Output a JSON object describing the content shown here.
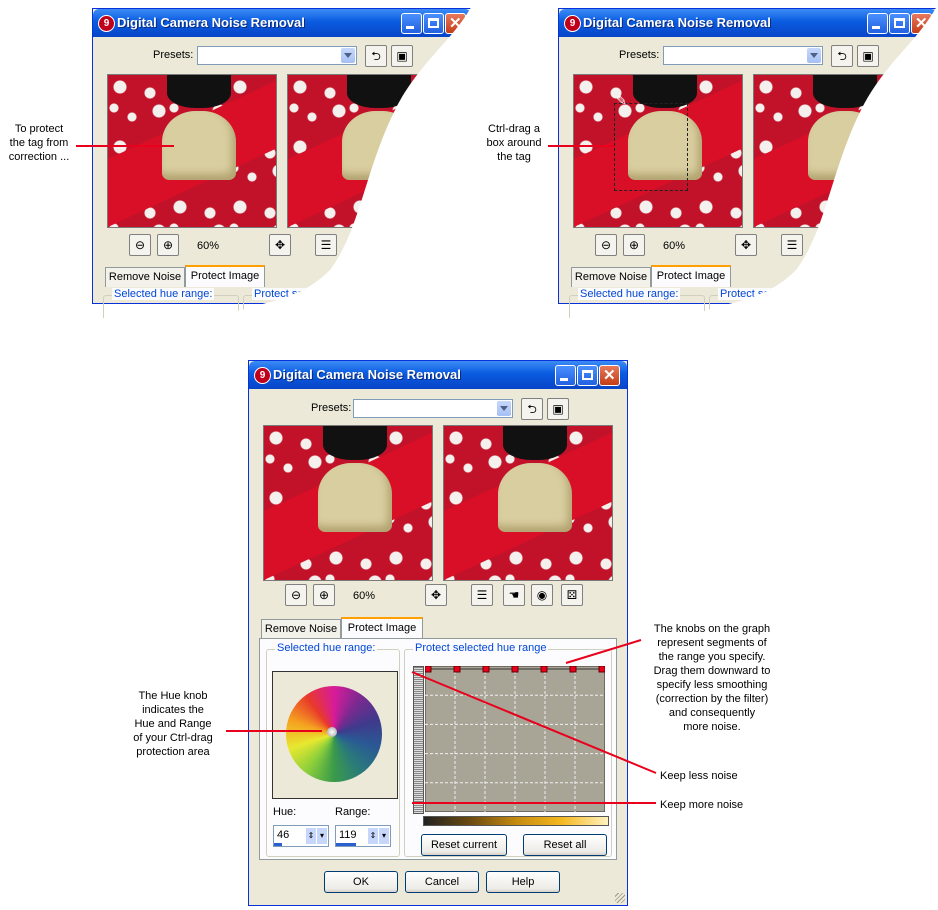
{
  "dialog": {
    "title": "Digital Camera Noise Removal",
    "app_icon": "9",
    "presets_label": "Presets:",
    "presets_value": "",
    "zoom": "60%",
    "tabs": [
      "Remove Noise",
      "Protect Image"
    ],
    "selected_hue_range": "Selected hue range:",
    "protect_selected_hue_range": "Protect selected hue range",
    "protect_selected_hue_range_cut": "Protect selecte",
    "hue_label": "Hue:",
    "hue_value": "46",
    "range_label": "Range:",
    "range_value": "119",
    "reset_current": "Reset current",
    "reset_all": "Reset all",
    "ok": "OK",
    "cancel": "Cancel",
    "help": "Help"
  },
  "annotations": {
    "protect_tag": "To protect\nthe tag from\ncorrection ...",
    "ctrl_drag": "Ctrl-drag a\nbox around\nthe tag",
    "hue_knob": "The Hue knob\nindicates the\nHue and Range\nof your Ctrl-drag\nprotection area",
    "graph_knobs": "The knobs on the graph\nrepresent segments of\nthe range you specify.\nDrag them downward to\nspecify less smoothing\n(correction by the filter)\nand consequently\nmore noise.",
    "keep_less": "Keep less noise",
    "keep_more": "Keep more noise"
  },
  "icons": {
    "zoom_out": "zoom-out-icon",
    "zoom_in": "zoom-in-icon",
    "pan": "pan-move-icon",
    "proof": "proof-toggle-icon",
    "reset_preset": "reset-arrow-icon",
    "save_preset": "save-disk-icon",
    "randomize": "dice-icon"
  },
  "colors": {
    "title_bar": "#0a5be0",
    "leader_lines": "#e8001c",
    "graph_bg": "#a8a597",
    "knob": "#e8001c"
  },
  "chart_data": {
    "type": "line",
    "knob_count": 7,
    "knob_level_fraction": [
      1,
      1,
      1,
      1,
      1,
      1,
      1
    ],
    "grid": true
  }
}
